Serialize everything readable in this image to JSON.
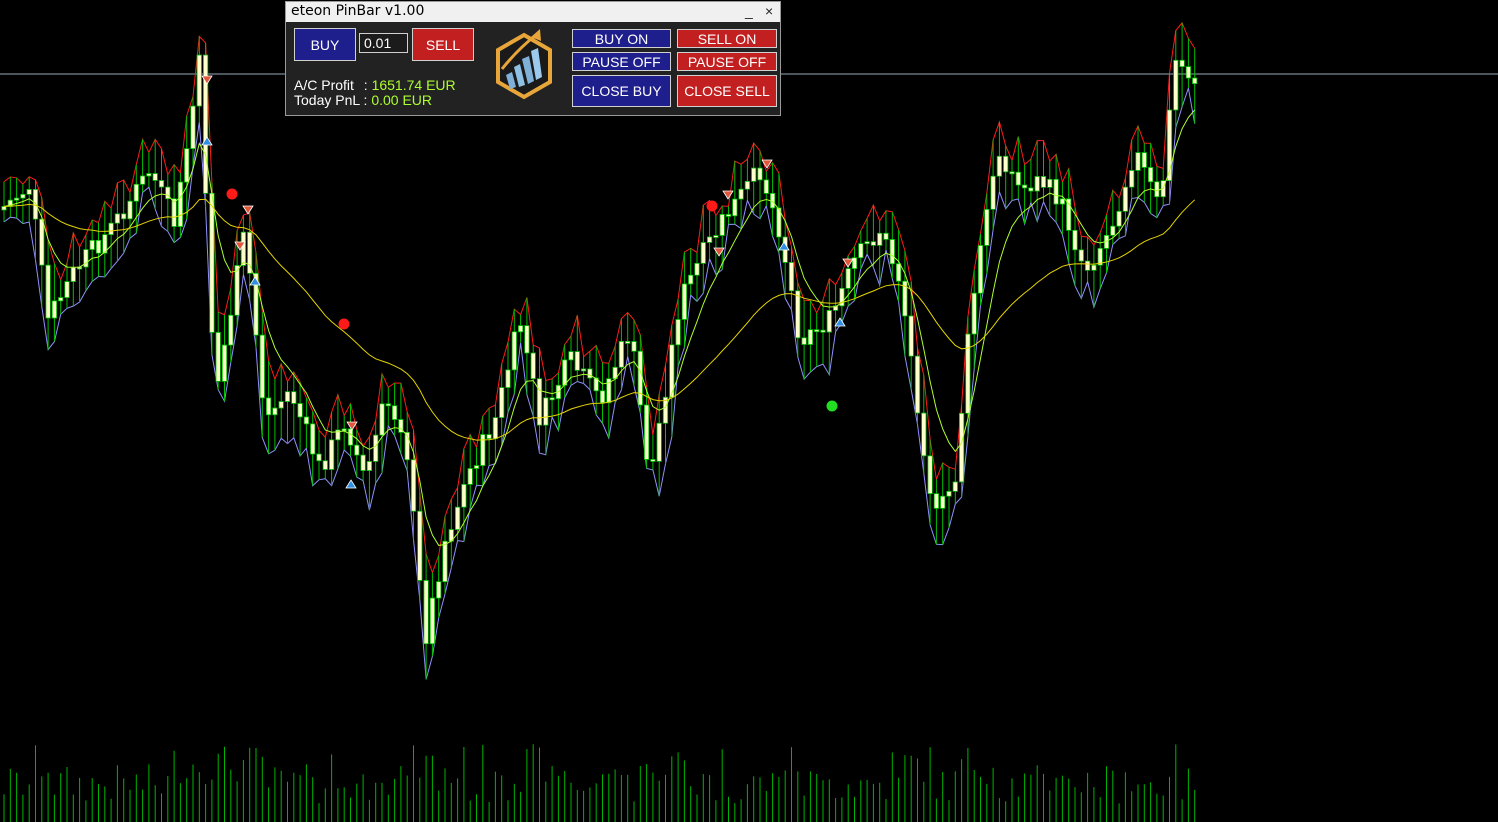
{
  "panel": {
    "title": "eteon PinBar v1.00",
    "minimize_label": "_",
    "close_label": "×",
    "buy_label": "BUY",
    "sell_label": "SELL",
    "lot_value": "0.01",
    "profit_label": "A/C Profit",
    "profit_sep": ":",
    "profit_value": "1651.74 EUR",
    "pnl_label": "Today PnL",
    "pnl_sep": ":",
    "pnl_value": "0.00 EUR",
    "buy_on_label": "BUY ON",
    "sell_on_label": "SELL ON",
    "pause_off_buy_label": "PAUSE OFF",
    "pause_off_sell_label": "PAUSE OFF",
    "close_buy_label": "CLOSE BUY",
    "close_sell_label": "CLOSE SELL"
  },
  "colors": {
    "background": "#000000",
    "candle_fill": "#ffffcc",
    "wick": "#00c000",
    "envelope_high": "#ff1a1a",
    "envelope_low": "#9090ff",
    "ma_fast": "#adff2f",
    "ma_slow": "#e5d400",
    "volume": "#00b400",
    "button_blue": "#1e1e8c",
    "button_red": "#c22020",
    "value_text": "#adff2f"
  },
  "icons": [
    "logo-icon",
    "up-arrow-icon",
    "down-arrow-icon",
    "signal-dot-icon"
  ]
}
